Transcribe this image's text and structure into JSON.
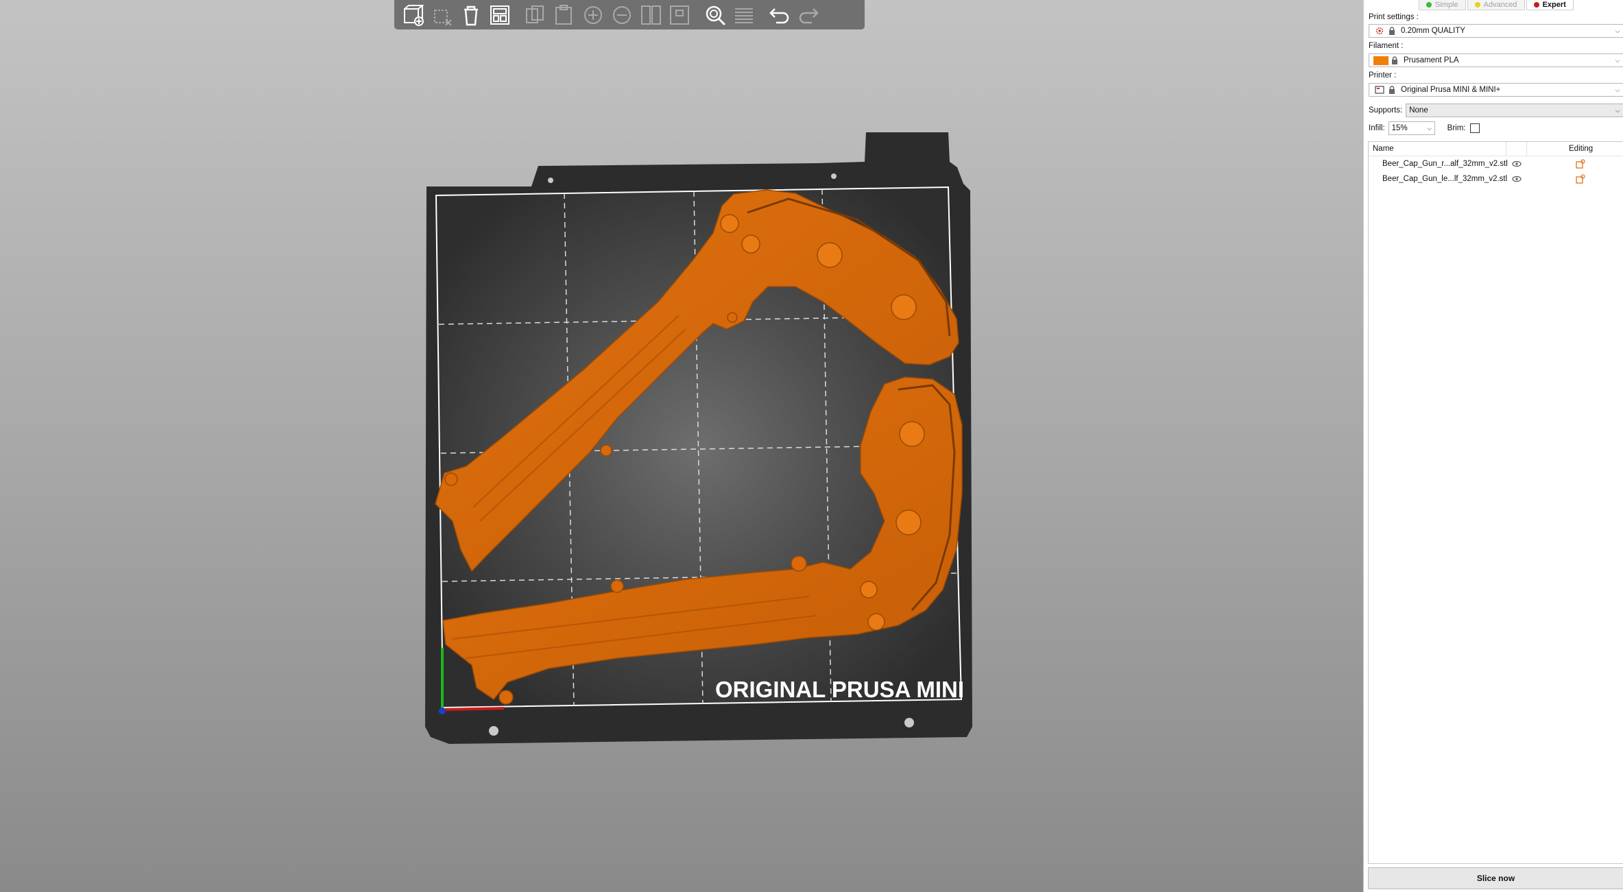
{
  "toolbar": {
    "buttons": [
      {
        "name": "add-icon",
        "enabled": true
      },
      {
        "name": "delete-icon",
        "enabled": false
      },
      {
        "name": "delete-all-icon",
        "enabled": true
      },
      {
        "name": "arrange-icon",
        "enabled": true
      },
      {
        "name": "copy-icon",
        "enabled": false
      },
      {
        "name": "paste-icon",
        "enabled": false
      },
      {
        "name": "add-instance-icon",
        "enabled": false
      },
      {
        "name": "remove-instance-icon",
        "enabled": false
      },
      {
        "name": "split-objects-icon",
        "enabled": false
      },
      {
        "name": "split-parts-icon",
        "enabled": false
      },
      {
        "name": "search-icon",
        "enabled": true
      },
      {
        "name": "layers-editing-icon",
        "enabled": false
      },
      {
        "name": "undo-icon",
        "enabled": true
      },
      {
        "name": "redo-icon",
        "enabled": false
      }
    ]
  },
  "bed": {
    "label": "ORIGINAL PRUSA MINI",
    "model_color": "#d9690b",
    "bed_color": "#2a2a2a"
  },
  "sidebar": {
    "modes": [
      {
        "label": "Simple",
        "color": "#35c035",
        "active": false
      },
      {
        "label": "Advanced",
        "color": "#e8d21a",
        "active": false
      },
      {
        "label": "Expert",
        "color": "#d01818",
        "active": true
      }
    ],
    "print_settings": {
      "label": "Print settings :",
      "value": "0.20mm QUALITY"
    },
    "filament": {
      "label": "Filament :",
      "value": "Prusament PLA",
      "color": "#f07f0a"
    },
    "printer": {
      "label": "Printer :",
      "value": "Original Prusa MINI & MINI+"
    },
    "supports": {
      "label": "Supports:",
      "value": "None"
    },
    "infill": {
      "label": "Infill:",
      "value": "15%"
    },
    "brim": {
      "label": "Brim:",
      "checked": false
    },
    "object_list": {
      "headers": {
        "name": "Name",
        "editing": "Editing"
      },
      "items": [
        {
          "name": "Beer_Cap_Gun_r...alf_32mm_v2.stl"
        },
        {
          "name": "Beer_Cap_Gun_le...lf_32mm_v2.stl"
        }
      ]
    },
    "slice_button": "Slice now"
  }
}
